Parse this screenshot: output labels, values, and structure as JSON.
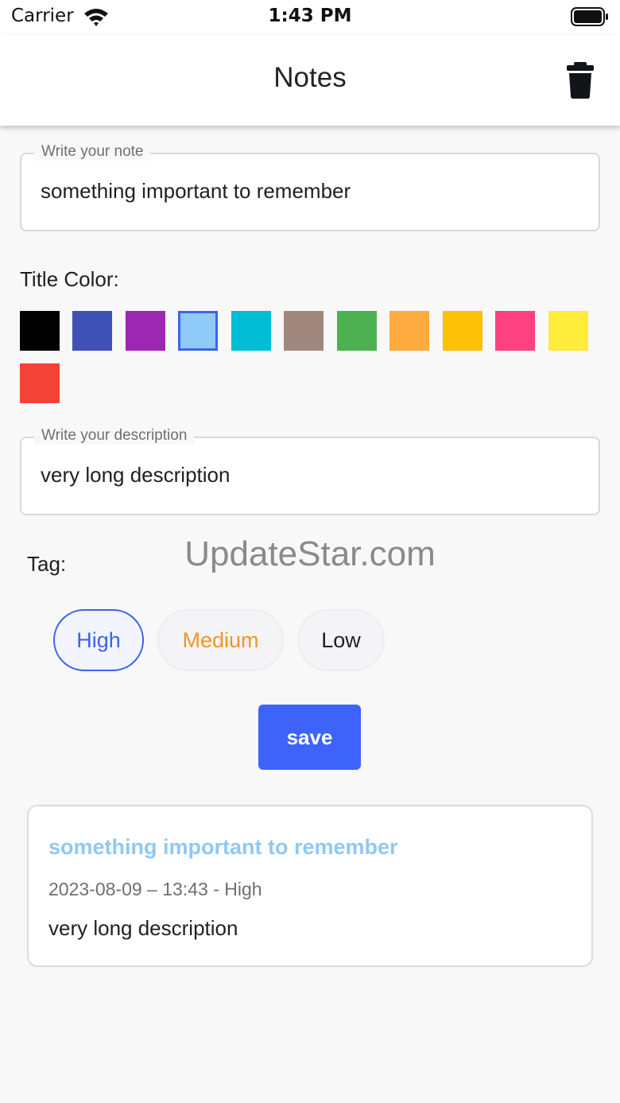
{
  "status_bar": {
    "carrier": "Carrier",
    "time": "1:43 PM"
  },
  "app_bar": {
    "title": "Notes",
    "delete_icon": "trash-icon"
  },
  "note_field": {
    "label": "Write your note",
    "value": "something important to remember"
  },
  "title_color": {
    "label": "Title Color:",
    "selected": "#90caf9",
    "swatches": [
      "#000000",
      "#3f51b5",
      "#9c27b0",
      "#90caf9",
      "#00bcd4",
      "#a1887f",
      "#4caf50",
      "#ffab40",
      "#ffc107",
      "#ff4081",
      "#ffeb3b",
      "#f44336"
    ]
  },
  "description_field": {
    "label": "Write your description",
    "value": "very long description"
  },
  "watermark": "UpdateStar.com",
  "tag": {
    "label": "Tag:",
    "selected": "High",
    "options": [
      {
        "label": "High",
        "color": "#3c63ec"
      },
      {
        "label": "Medium",
        "color": "#f7931e"
      },
      {
        "label": "Low",
        "color": "#1f1f24"
      }
    ]
  },
  "save_label": "save",
  "notes": [
    {
      "title": "something important to remember",
      "title_color": "#8fc8f5",
      "meta": "2023-08-09 – 13:43 - High",
      "description": "very long description"
    }
  ]
}
